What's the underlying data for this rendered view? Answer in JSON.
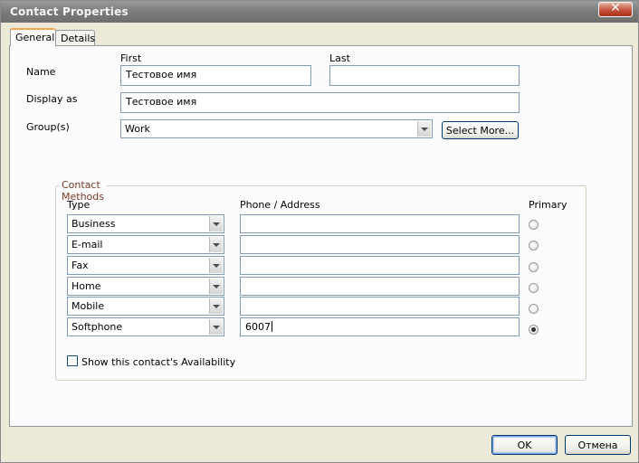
{
  "window": {
    "title": "Contact Properties"
  },
  "tabs": [
    {
      "label": "General"
    },
    {
      "label": "Details"
    }
  ],
  "name_section": {
    "row_label": "Name",
    "first_label": "First",
    "last_label": "Last",
    "first_value": "Тестовое имя",
    "last_value": ""
  },
  "display_as": {
    "label": "Display as",
    "value": "Тестовое имя"
  },
  "groups": {
    "label": "Group(s)",
    "value": "Work",
    "select_more_label": "Select More..."
  },
  "contact_methods": {
    "title": "Contact Methods",
    "type_header": "Type",
    "address_header": "Phone / Address",
    "primary_header": "Primary",
    "rows": [
      {
        "type": "Business",
        "value": "",
        "primary": false
      },
      {
        "type": "E-mail",
        "value": "",
        "primary": false
      },
      {
        "type": "Fax",
        "value": "",
        "primary": false
      },
      {
        "type": "Home",
        "value": "",
        "primary": false
      },
      {
        "type": "Mobile",
        "value": "",
        "primary": false
      },
      {
        "type": "Softphone",
        "value": "6007",
        "primary": true
      }
    ],
    "availability_label": "Show this contact's Availability",
    "availability_checked": false
  },
  "footer": {
    "ok_label": "OK",
    "cancel_label": "Отмена"
  }
}
